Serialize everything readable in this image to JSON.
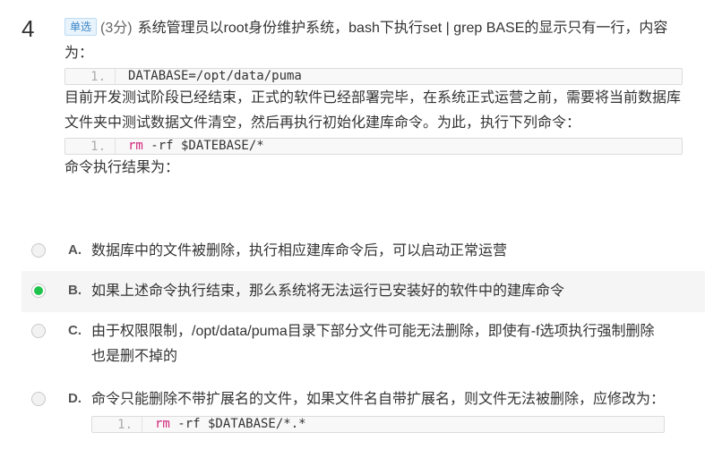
{
  "question": {
    "number": "4",
    "type_badge": "单选",
    "score": "(3分)",
    "intro": "系统管理员以root身份维护系统，bash下执行set | grep BASE的显示只有一行，内容为：",
    "code1": {
      "line_no": "1.",
      "text": "DATABASE=/opt/data/puma"
    },
    "middle": "目前开发测试阶段已经结束，正式的软件已经部署完毕，在系统正式运营之前，需要将当前数据库文件夹中测试数据文件清空，然后再执行初始化建库命令。为此，执行下列命令：",
    "code2": {
      "line_no": "1.",
      "keyword": "rm",
      "rest": " -rf $DATEBASE/*"
    },
    "result_prompt": "命令执行结果为："
  },
  "options": [
    {
      "letter": "A.",
      "text": "数据库中的文件被删除，执行相应建库命令后，可以启动正常运营",
      "selected": false
    },
    {
      "letter": "B.",
      "text": "如果上述命令执行结束，那么系统将无法运行已安装好的软件中的建库命令",
      "selected": true
    },
    {
      "letter": "C.",
      "text": "由于权限限制，/opt/data/puma目录下部分文件可能无法删除，即使有-f选项执行强制删除也是删不掉的",
      "selected": false
    },
    {
      "letter": "D.",
      "text": "命令只能删除不带扩展名的文件，如果文件名自带扩展名，则文件无法被删除，应修改为：",
      "selected": false,
      "code": {
        "line_no": "1.",
        "keyword": "rm",
        "rest": " -rf $DATABASE/*.*"
      }
    }
  ],
  "colors": {
    "selected_radio": "#1fc34c",
    "code_keyword": "#d0267a",
    "badge": "#3a86c8"
  }
}
